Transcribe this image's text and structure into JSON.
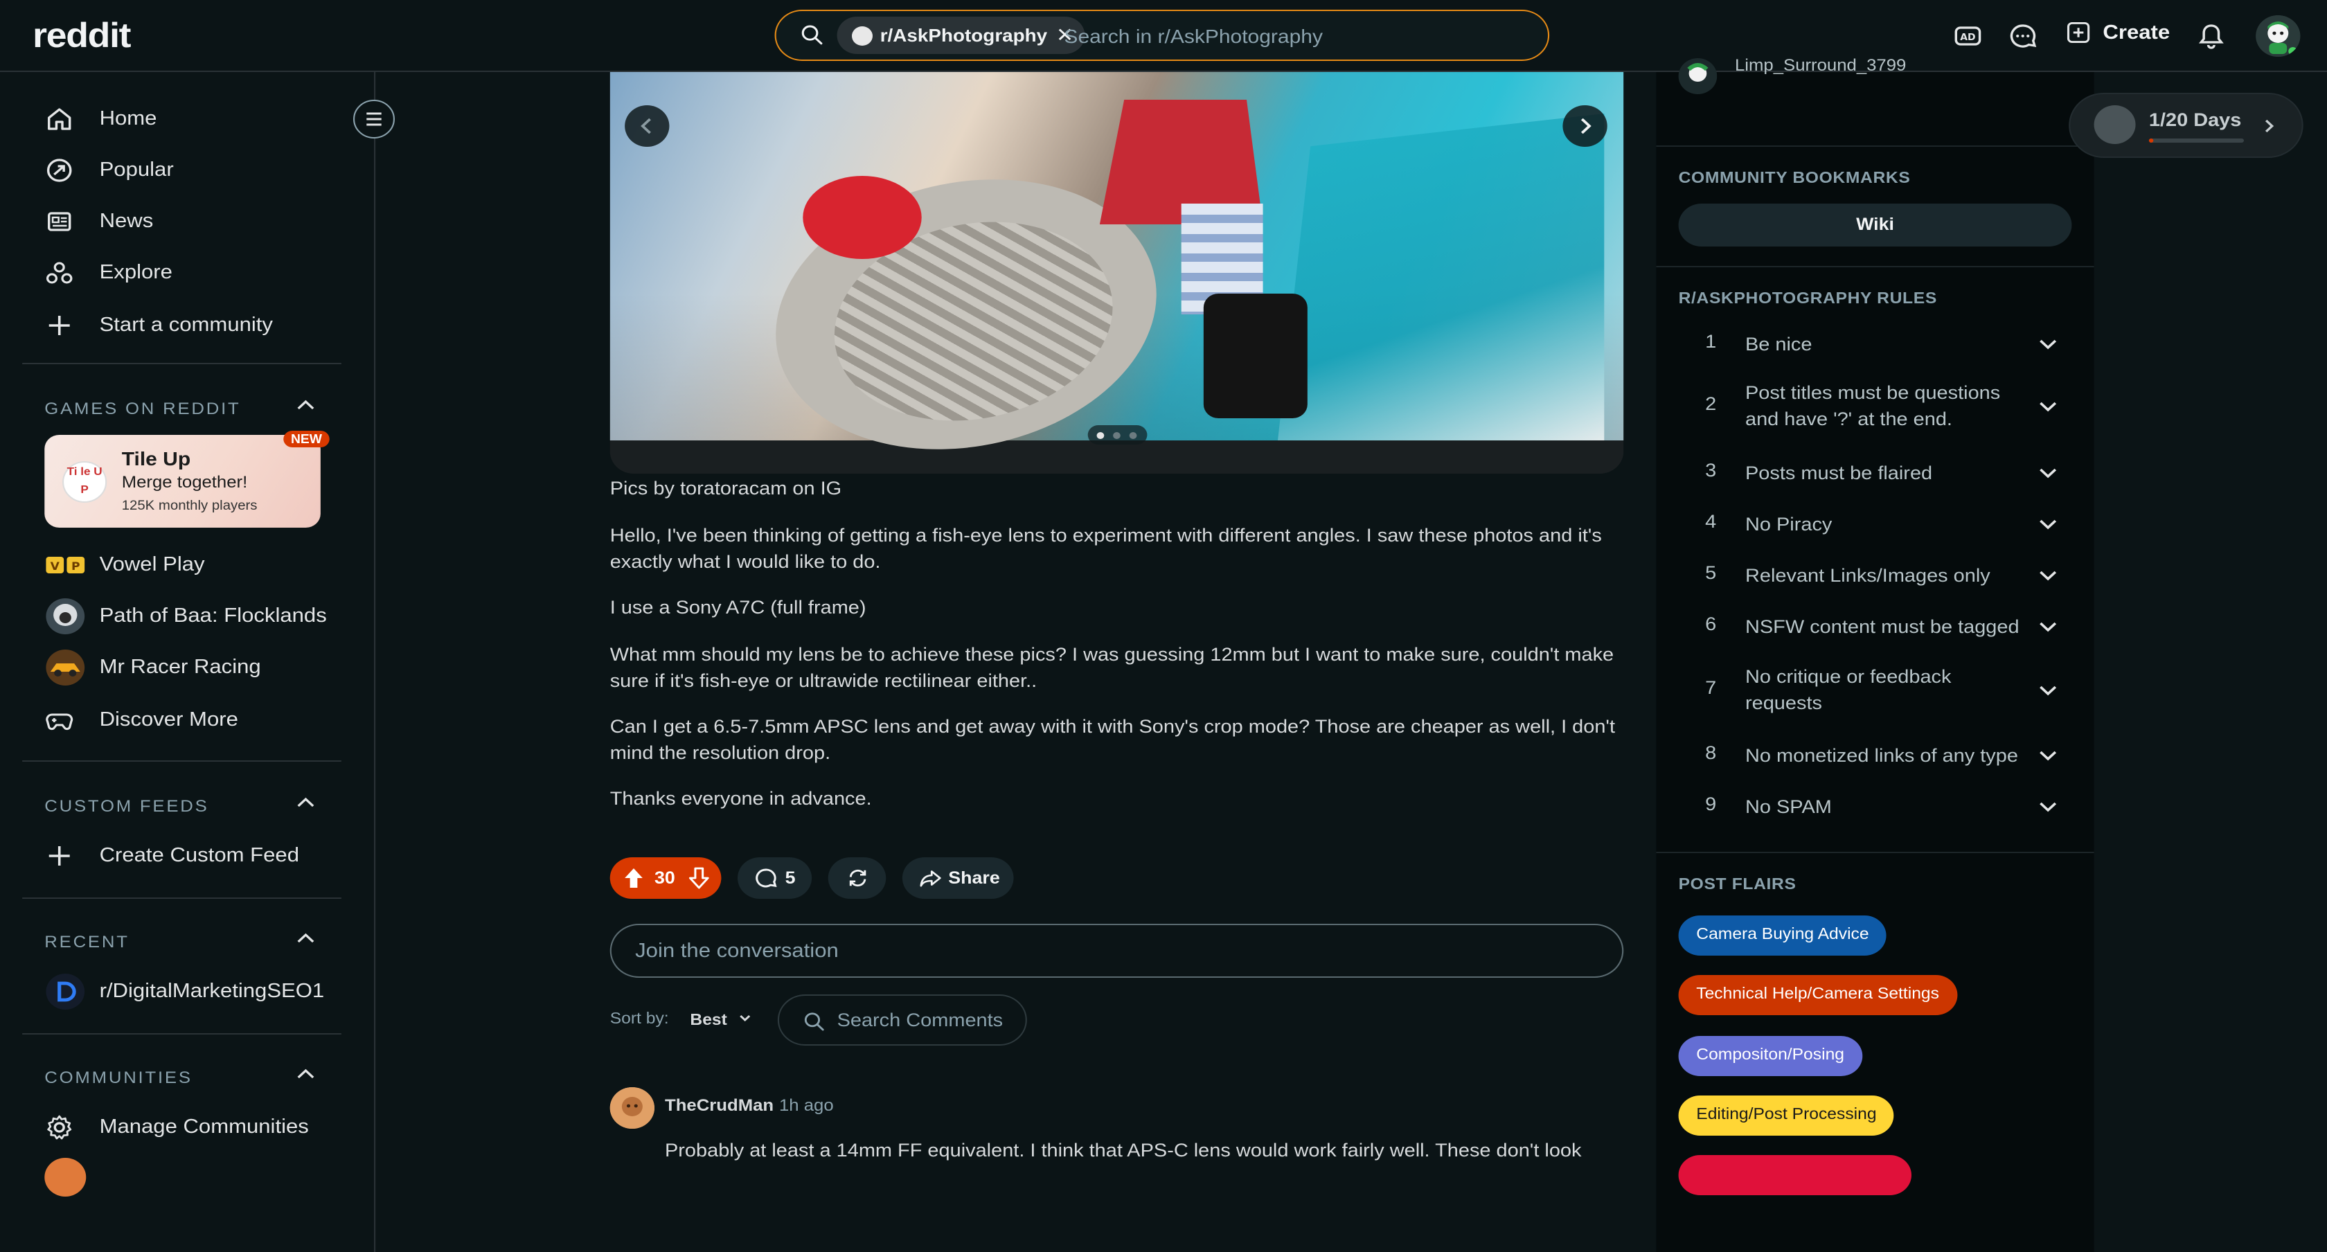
{
  "header": {
    "logo": "reddit",
    "search_chip": "r/AskPhotography",
    "search_placeholder": "Search in r/AskPhotography",
    "create_label": "Create"
  },
  "sidebar": {
    "nav": [
      "Home",
      "Popular",
      "News",
      "Explore",
      "Start a community"
    ],
    "games_title": "GAMES ON REDDIT",
    "featured_game": {
      "title": "Tile Up",
      "subtitle": "Merge together!",
      "players": "125K monthly players",
      "badge": "NEW",
      "icon_text": "Ti le U P"
    },
    "games": [
      "Vowel Play",
      "Path of Baa: Flocklands",
      "Mr Racer Racing",
      "Discover More"
    ],
    "custom_feeds_title": "CUSTOM FEEDS",
    "create_feed": "Create Custom Feed",
    "recent_title": "RECENT",
    "recent": [
      "r/DigitalMarketingSEO1"
    ],
    "communities_title": "COMMUNITIES",
    "manage_communities": "Manage Communities"
  },
  "post": {
    "caption": "Pics by toratoracam on IG",
    "paragraphs": [
      "Hello, I've been thinking of getting a fish-eye lens to experiment with different angles. I saw these photos and it's exactly what I would like to do.",
      "I use a Sony A7C (full frame)",
      "What mm should my lens be to achieve these pics? I was guessing 12mm but I want to make sure, couldn't make sure if it's fish-eye or ultrawide rectilinear either..",
      "Can I get a 6.5-7.5mm APSC lens and get away with it with Sony's crop mode? Those are cheaper as well, I don't mind the resolution drop.",
      "Thanks everyone in advance."
    ],
    "votes": "30",
    "comments_count": "5",
    "share_label": "Share",
    "join_placeholder": "Join the conversation",
    "sort_label": "Sort by:",
    "sort_value": "Best",
    "search_comments": "Search Comments",
    "carousel": {
      "current": 1,
      "total": 3
    }
  },
  "comment": {
    "user": "TheCrudMan",
    "time": "1h ago",
    "text": "Probably at least a 14mm FF equivalent. I think that APS-C lens would work fairly well. These don't look"
  },
  "right": {
    "top_user": "Limp_Surround_3799",
    "bookmarks_title": "COMMUNITY BOOKMARKS",
    "wiki": "Wiki",
    "rules_title": "R/ASKPHOTOGRAPHY RULES",
    "rules": [
      {
        "n": "1",
        "t": "Be nice"
      },
      {
        "n": "2",
        "t": "Post titles must be questions and have '?' at the end."
      },
      {
        "n": "3",
        "t": "Posts must be flaired"
      },
      {
        "n": "4",
        "t": "No Piracy"
      },
      {
        "n": "5",
        "t": "Relevant Links/Images only"
      },
      {
        "n": "6",
        "t": "NSFW content must be tagged"
      },
      {
        "n": "7",
        "t": "No critique or feedback requests"
      },
      {
        "n": "8",
        "t": "No monetized links of any type"
      },
      {
        "n": "9",
        "t": "No SPAM"
      }
    ],
    "flairs_title": "POST FLAIRS",
    "flairs": [
      {
        "label": "Camera Buying Advice",
        "bg": "#0e5aa7",
        "fg": "#ffffff"
      },
      {
        "label": "Technical Help/Camera Settings",
        "bg": "#cc3600",
        "fg": "#ffffff"
      },
      {
        "label": "Compositon/Posing",
        "bg": "#646ed4",
        "fg": "#ffffff"
      },
      {
        "label": "Editing/Post Processing",
        "bg": "#ffd635",
        "fg": "#1a1a1a"
      }
    ]
  },
  "streak": {
    "label": "1/20 Days",
    "progress": 0.05
  }
}
